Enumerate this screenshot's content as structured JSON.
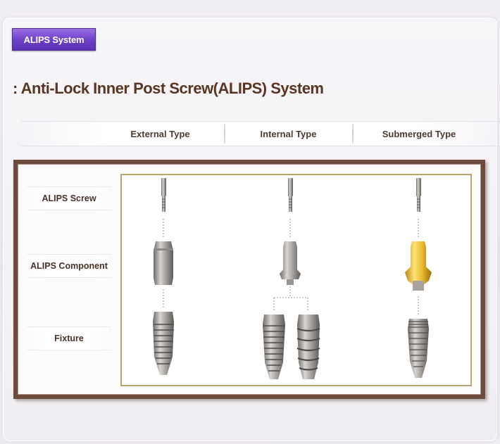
{
  "header": {
    "badge_label": "ALIPS System",
    "title": ": Anti-Lock Inner Post Screw(ALIPS) System"
  },
  "tabs": [
    {
      "label": "External Type"
    },
    {
      "label": "Internal Type"
    },
    {
      "label": "Submerged Type"
    }
  ],
  "rows": [
    {
      "label": "ALIPS Screw"
    },
    {
      "label": "ALIPS Component"
    },
    {
      "label": "Fixture"
    }
  ],
  "colors": {
    "badge": "#6b3fc8",
    "frame": "#6e4b3e",
    "inner_border": "#b9a472",
    "title": "#5a3424",
    "gold_component": "#e8b92c"
  }
}
